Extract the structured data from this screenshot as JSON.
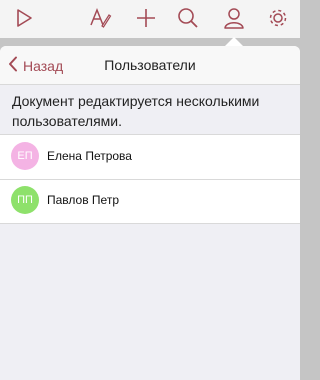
{
  "toolbar": {
    "icons": [
      "play-icon",
      "text-edit-icon",
      "add-icon",
      "search-icon",
      "user-icon",
      "settings-gear-icon"
    ],
    "icon_color": "#a34a55"
  },
  "popover": {
    "back_label": "Назад",
    "title": "Пользователи",
    "description": "Документ редактируется несколькими пользователями."
  },
  "users": [
    {
      "initials": "ЕП",
      "name": "Елена Петрова",
      "color": "#f4b3e4"
    },
    {
      "initials": "ПП",
      "name": "Павлов Петр",
      "color": "#8ee16b"
    }
  ],
  "colors": {
    "accent": "#a34a55",
    "background_dim": "#c5c5c5",
    "list_background": "#efeff4"
  }
}
